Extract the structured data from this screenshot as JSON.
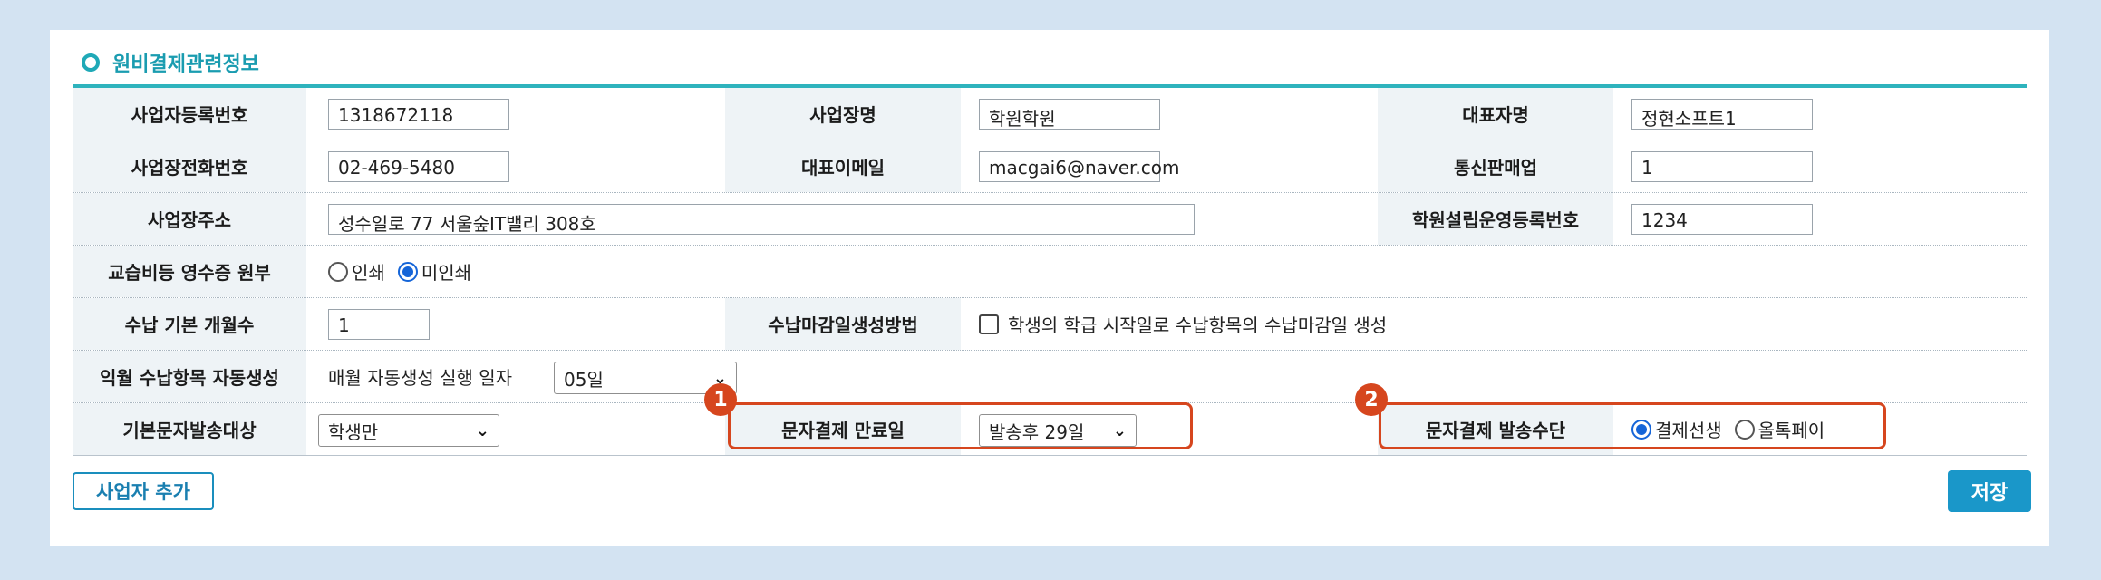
{
  "section": {
    "title": "원비결제관련정보"
  },
  "rows": {
    "r1": {
      "biz_reg_label": "사업자등록번호",
      "biz_reg_value": "1318672118",
      "biz_name_label": "사업장명",
      "biz_name_value": "학원학원",
      "rep_name_label": "대표자명",
      "rep_name_value": "정현소프트1"
    },
    "r2": {
      "biz_phone_label": "사업장전화번호",
      "biz_phone_value": "02-469-5480",
      "rep_email_label": "대표이메일",
      "rep_email_value": "macgai6@naver.com",
      "mail_order_label": "통신판매업",
      "mail_order_value": "1"
    },
    "r3": {
      "address_label": "사업장주소",
      "address_value": "성수일로 77 서울숲IT밸리 308호",
      "academy_reg_label": "학원설립운영등록번호",
      "academy_reg_value": "1234"
    },
    "r4": {
      "label": "교습비등 영수증 원부",
      "opt_print": "인쇄",
      "opt_noprint": "미인쇄",
      "selected": "미인쇄"
    },
    "r5": {
      "months_label": "수납 기본 개월수",
      "months_value": "1",
      "deadline_label": "수납마감일생성방법",
      "deadline_checkbox": "학생의 학급 시작일로 수납항목의 수납마감일 생성",
      "checked": false
    },
    "r6": {
      "label": "익월 수납항목 자동생성",
      "text": "매월 자동생성 실행 일자",
      "day_value": "05일"
    },
    "r7": {
      "sms_target_label": "기본문자발송대상",
      "sms_target_value": "학생만",
      "sms_expire_label": "문자결제 만료일",
      "sms_expire_value": "발송후 29일",
      "sms_method_label": "문자결제 발송수단",
      "opt_pay": "결제선생",
      "opt_allpay": "올톡페이",
      "selected": "결제선생"
    }
  },
  "badges": {
    "one": "1",
    "two": "2"
  },
  "buttons": {
    "add_business": "사업자 추가",
    "save": "저장"
  },
  "colors": {
    "accent": "#1a9cb0",
    "highlight": "#d6461e",
    "save_button": "#1a97c9",
    "background": "#d3e3f2"
  }
}
